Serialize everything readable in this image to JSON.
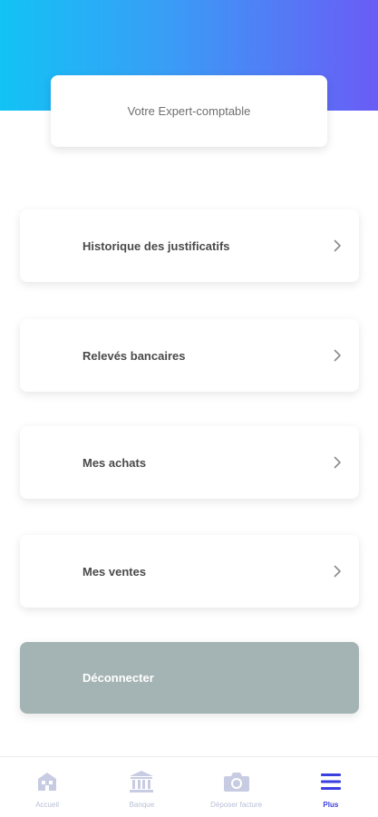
{
  "header": {
    "gradient_start": "#12c3f5",
    "gradient_end": "#6a5cf6",
    "expert_label": "Votre Expert-comptable"
  },
  "menu": {
    "items": [
      {
        "label": "Historique des justificatifs",
        "icon": "chevron-right-icon"
      },
      {
        "label": "Relevés bancaires",
        "icon": "chevron-right-icon"
      },
      {
        "label": "Mes achats",
        "icon": "chevron-right-icon"
      },
      {
        "label": "Mes ventes",
        "icon": "chevron-right-icon"
      }
    ],
    "logout_label": "Déconnecter",
    "logout_color": "#a4b3b3"
  },
  "tabbar": {
    "tabs": [
      {
        "label": "Accueil",
        "icon": "home-icon",
        "active": false
      },
      {
        "label": "Banque",
        "icon": "bank-icon",
        "active": false
      },
      {
        "label": "Déposer facture",
        "icon": "camera-icon",
        "active": false
      },
      {
        "label": "Plus",
        "icon": "menu-icon",
        "active": true
      }
    ],
    "active_color": "#3b3fe0",
    "inactive_color": "#b9bed6"
  }
}
